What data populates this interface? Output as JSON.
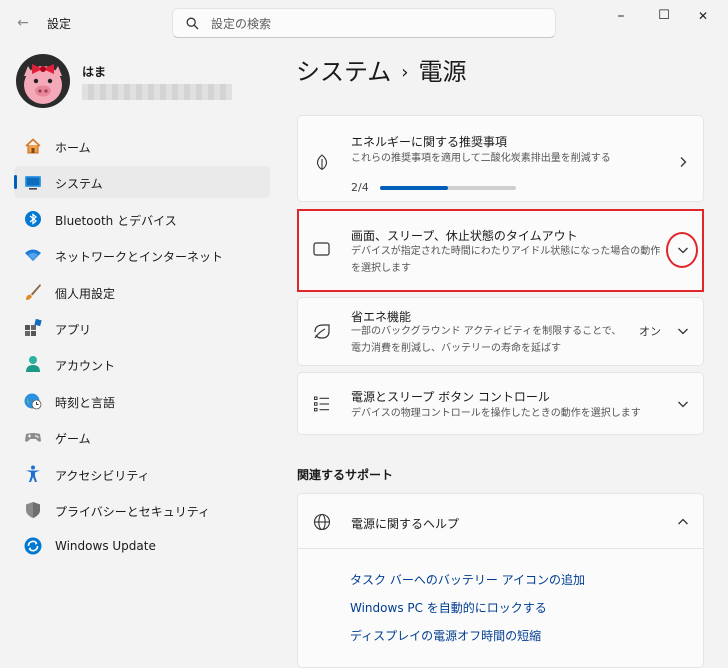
{
  "window": {
    "app_title": "設定",
    "search_placeholder": "設定の検索",
    "controls": {
      "minimize": "–",
      "maximize": "☐",
      "close": "✕"
    }
  },
  "profile": {
    "name": "はま"
  },
  "sidebar": {
    "items": [
      {
        "label": "ホーム",
        "icon": "home-icon",
        "active": false
      },
      {
        "label": "システム",
        "icon": "system-icon",
        "active": true
      },
      {
        "label": "Bluetooth とデバイス",
        "icon": "bluetooth-icon",
        "active": false
      },
      {
        "label": "ネットワークとインターネット",
        "icon": "wifi-icon",
        "active": false
      },
      {
        "label": "個人用設定",
        "icon": "brush-icon",
        "active": false
      },
      {
        "label": "アプリ",
        "icon": "apps-icon",
        "active": false
      },
      {
        "label": "アカウント",
        "icon": "account-icon",
        "active": false
      },
      {
        "label": "時刻と言語",
        "icon": "globe-clock-icon",
        "active": false
      },
      {
        "label": "ゲーム",
        "icon": "gamepad-icon",
        "active": false
      },
      {
        "label": "アクセシビリティ",
        "icon": "accessibility-icon",
        "active": false
      },
      {
        "label": "プライバシーとセキュリティ",
        "icon": "shield-icon",
        "active": false
      },
      {
        "label": "Windows Update",
        "icon": "update-icon",
        "active": false
      }
    ]
  },
  "main": {
    "breadcrumb": {
      "parent": "システム",
      "separator": "›",
      "current": "電源"
    },
    "cards": {
      "energy": {
        "title": "エネルギーに関する推奨事項",
        "desc": "これらの推奨事項を適用して二酸化炭素排出量を削減する",
        "progress_label": "2/4",
        "progress": 0.5
      },
      "timeout": {
        "title": "画面、スリープ、休止状態のタイムアウト",
        "desc": "デバイスが指定された時間にわたりアイドル状態になった場合の動作を選択します"
      },
      "saver": {
        "title": "省エネ機能",
        "desc": "一部のバックグラウンド アクティビティを制限することで、電力消費を削減し、バッテリーの寿命を延ばす",
        "state": "オン"
      },
      "buttons": {
        "title": "電源とスリープ ボタン コントロール",
        "desc": "デバイスの物理コントロールを操作したときの動作を選択します"
      }
    },
    "support": {
      "heading": "関連するサポート",
      "help_title": "電源に関するヘルプ",
      "links": [
        "タスク バーへのバッテリー アイコンの追加",
        "Windows PC を自動的にロックする",
        "ディスプレイの電源オフ時間の短縮"
      ]
    }
  },
  "colors": {
    "accent": "#005fb8",
    "highlight": "#e0262b",
    "link": "#003e92"
  }
}
